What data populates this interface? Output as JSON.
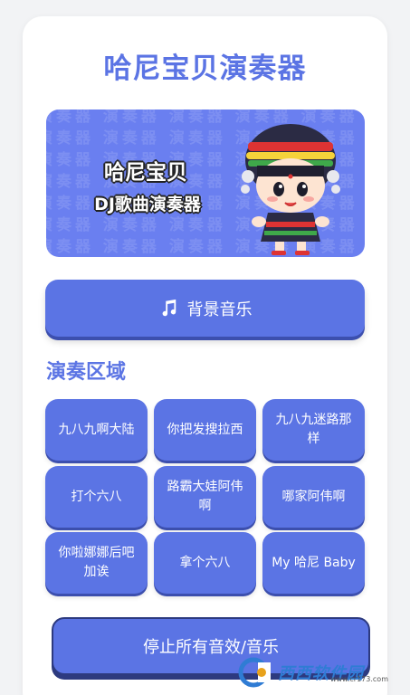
{
  "app": {
    "title": "哈尼宝贝演奏器"
  },
  "banner": {
    "line1": "哈尼宝贝",
    "line2": "DJ歌曲演奏器",
    "pattern_text": "演奏器"
  },
  "bgm_button": {
    "icon": "music-note-icon",
    "label": "背景音乐"
  },
  "section": {
    "title": "演奏区域"
  },
  "sounds": [
    "九八九啊大陆",
    "你把发搜拉西",
    "九八九迷路那样",
    "打个六八",
    "路霸大娃阿伟啊",
    "哪家阿伟啊",
    "你啦娜娜后吧加诶",
    "拿个六八",
    "My 哈尼 Baby"
  ],
  "stop_button": {
    "label": "停止所有音效/音乐"
  },
  "watermark": {
    "text": "西西软件园",
    "sub": "www.cr173.com"
  },
  "colors": {
    "primary": "#5b74e4",
    "banner": "#6a7ff0",
    "button_shadow": "#3c4fae",
    "background": "#f2f3f5"
  }
}
